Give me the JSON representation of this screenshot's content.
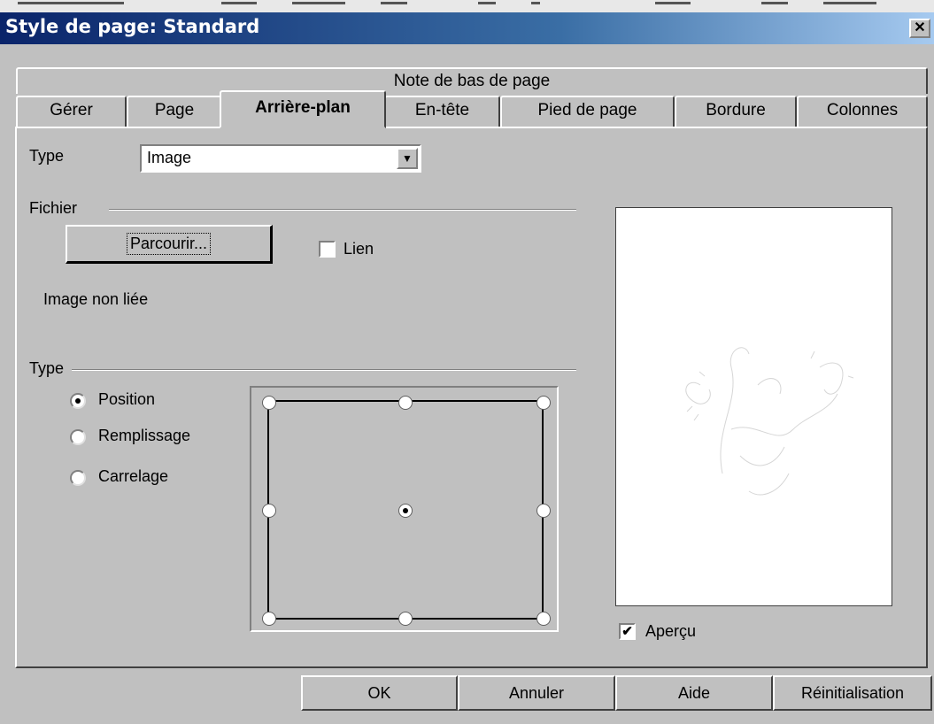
{
  "window": {
    "title": "Style de page: Standard",
    "close_glyph": "✕"
  },
  "tabs": {
    "row1": [
      "Note de bas de page"
    ],
    "row2": [
      "Gérer",
      "Page",
      "Arrière-plan",
      "En-tête",
      "Pied de page",
      "Bordure",
      "Colonnes"
    ],
    "active": "Arrière-plan"
  },
  "background_tab": {
    "type_label": "Type",
    "type_value": "Image",
    "file_group_label": "Fichier",
    "browse_label": "Parcourir...",
    "link_label": "Lien",
    "link_checked": false,
    "link_status": "Image non liée",
    "type_group_label": "Type",
    "radios": [
      {
        "label": "Position",
        "selected": true
      },
      {
        "label": "Remplissage",
        "selected": false
      },
      {
        "label": "Carrelage",
        "selected": false
      }
    ],
    "position_selected": "center",
    "preview_label": "Aperçu",
    "preview_checked": true
  },
  "buttons": {
    "ok": "OK",
    "cancel": "Annuler",
    "help": "Aide",
    "reset": "Réinitialisation"
  },
  "icons": {
    "dropdown": "chevron-down-icon",
    "close": "close-icon",
    "checkmark": "checkmark-icon"
  }
}
